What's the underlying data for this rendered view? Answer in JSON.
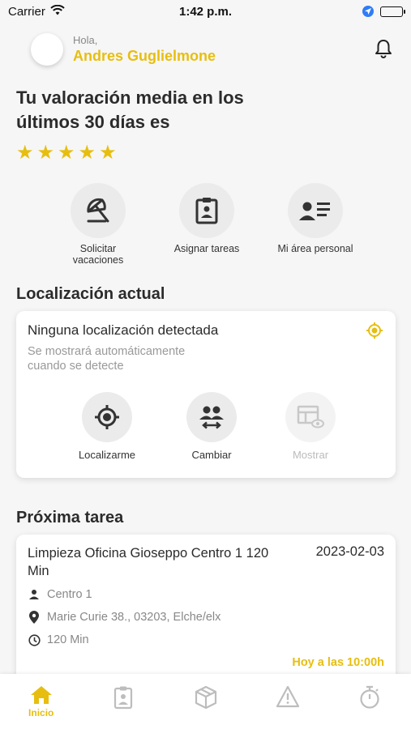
{
  "status_bar": {
    "carrier": "Carrier",
    "time": "1:42 p.m."
  },
  "header": {
    "greeting": "Hola,",
    "user_name": "Andres Guglielmone"
  },
  "rating": {
    "title": "Tu valoración media en los últimos 30 días es",
    "stars": 5,
    "max_stars": 5
  },
  "quick_actions": [
    {
      "label": "Solicitar vacaciones",
      "icon": "umbrella-icon"
    },
    {
      "label": "Asignar tareas",
      "icon": "clipboard-person-icon"
    },
    {
      "label": "Mi área personal",
      "icon": "person-list-icon"
    }
  ],
  "location": {
    "section_title": "Localización actual",
    "card_title": "Ninguna localización detectada",
    "card_subtitle": "Se mostrará automáticamente cuando se detecte",
    "buttons": [
      {
        "label": "Localizarme",
        "icon": "crosshair-icon",
        "enabled": true
      },
      {
        "label": "Cambiar",
        "icon": "people-swap-icon",
        "enabled": true
      },
      {
        "label": "Mostrar",
        "icon": "view-table-icon",
        "enabled": false
      }
    ]
  },
  "next_task": {
    "section_title": "Próxima tarea",
    "name": "Limpieza Oficina Gioseppo Centro 1 120 Min",
    "date": "2023-02-03",
    "center": "Centro 1",
    "address": "Marie Curie 38., 03203, Elche/elx",
    "duration": "120 Min",
    "when": "Hoy a las 10:00h"
  },
  "tabbar": {
    "active": "Inicio",
    "tabs": [
      {
        "label": "Inicio",
        "icon": "home-icon"
      },
      {
        "label": "",
        "icon": "clipboard-icon"
      },
      {
        "label": "",
        "icon": "box-icon"
      },
      {
        "label": "",
        "icon": "warning-icon"
      },
      {
        "label": "",
        "icon": "stopwatch-icon"
      }
    ]
  },
  "colors": {
    "accent": "#e7be10",
    "text": "#2b2b2b",
    "muted": "#888888",
    "background": "#f6f6f6"
  }
}
